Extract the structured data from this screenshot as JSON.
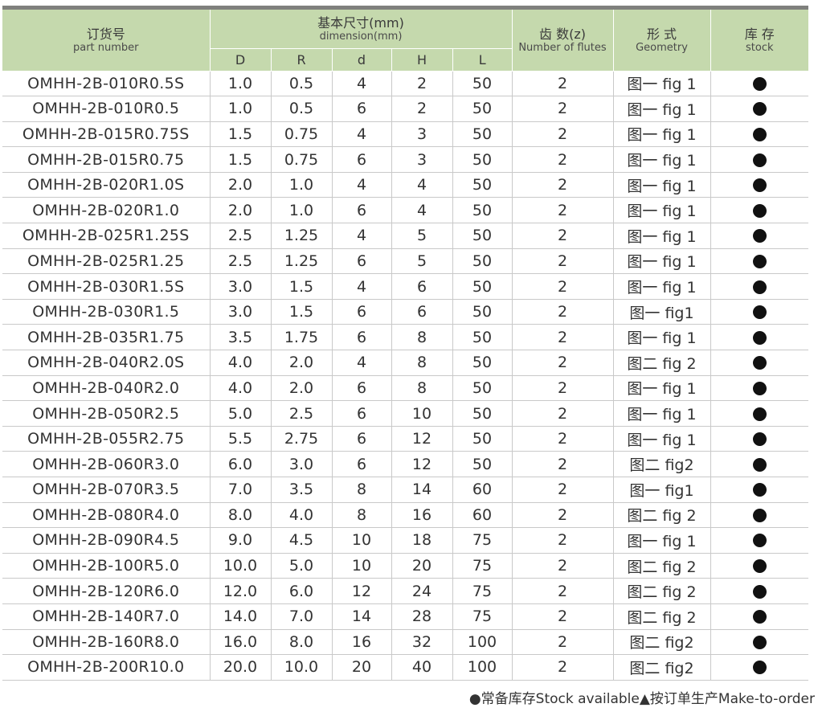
{
  "header": {
    "part_zh": "订货号",
    "part_en": "part number",
    "dim_zh": "基本尺寸(mm)",
    "dim_en": "dimension(mm)",
    "sub": [
      "D",
      "R",
      "d",
      "H",
      "L"
    ],
    "flutes_zh": "齿 数(z)",
    "flutes_en": "Number of flutes",
    "geom_zh": "形 式",
    "geom_en": "Geometry",
    "stock_zh": "库 存",
    "stock_en": "stock"
  },
  "rows": [
    {
      "pn": "OMHH-2B-010R0.5S",
      "D": "1.0",
      "R": "0.5",
      "d": "4",
      "H": "2",
      "L": "50",
      "z": "2",
      "geo": "图一 fig 1",
      "stock": "●"
    },
    {
      "pn": "OMHH-2B-010R0.5",
      "D": "1.0",
      "R": "0.5",
      "d": "6",
      "H": "2",
      "L": "50",
      "z": "2",
      "geo": "图一 fig 1",
      "stock": "●"
    },
    {
      "pn": "OMHH-2B-015R0.75S",
      "D": "1.5",
      "R": "0.75",
      "d": "4",
      "H": "3",
      "L": "50",
      "z": "2",
      "geo": "图一 fig 1",
      "stock": "●"
    },
    {
      "pn": "OMHH-2B-015R0.75",
      "D": "1.5",
      "R": "0.75",
      "d": "6",
      "H": "3",
      "L": "50",
      "z": "2",
      "geo": "图一 fig 1",
      "stock": "●"
    },
    {
      "pn": "OMHH-2B-020R1.0S",
      "D": "2.0",
      "R": "1.0",
      "d": "4",
      "H": "4",
      "L": "50",
      "z": "2",
      "geo": "图一 fig 1",
      "stock": "●"
    },
    {
      "pn": "OMHH-2B-020R1.0",
      "D": "2.0",
      "R": "1.0",
      "d": "6",
      "H": "4",
      "L": "50",
      "z": "2",
      "geo": "图一 fig 1",
      "stock": "●"
    },
    {
      "pn": "OMHH-2B-025R1.25S",
      "D": "2.5",
      "R": "1.25",
      "d": "4",
      "H": "5",
      "L": "50",
      "z": "2",
      "geo": "图一 fig 1",
      "stock": "●"
    },
    {
      "pn": "OMHH-2B-025R1.25",
      "D": "2.5",
      "R": "1.25",
      "d": "6",
      "H": "5",
      "L": "50",
      "z": "2",
      "geo": "图一 fig 1",
      "stock": "●"
    },
    {
      "pn": "OMHH-2B-030R1.5S",
      "D": "3.0",
      "R": "1.5",
      "d": "4",
      "H": "6",
      "L": "50",
      "z": "2",
      "geo": "图一 fig 1",
      "stock": "●"
    },
    {
      "pn": "OMHH-2B-030R1.5",
      "D": "3.0",
      "R": "1.5",
      "d": "6",
      "H": "6",
      "L": "50",
      "z": "2",
      "geo": "图一 fig1",
      "stock": "●"
    },
    {
      "pn": "OMHH-2B-035R1.75",
      "D": "3.5",
      "R": "1.75",
      "d": "6",
      "H": "8",
      "L": "50",
      "z": "2",
      "geo": "图一 fig 1",
      "stock": "●"
    },
    {
      "pn": "OMHH-2B-040R2.0S",
      "D": "4.0",
      "R": "2.0",
      "d": "4",
      "H": "8",
      "L": "50",
      "z": "2",
      "geo": "图二 fig 2",
      "stock": "●"
    },
    {
      "pn": "OMHH-2B-040R2.0",
      "D": "4.0",
      "R": "2.0",
      "d": "6",
      "H": "8",
      "L": "50",
      "z": "2",
      "geo": "图一 fig 1",
      "stock": "●"
    },
    {
      "pn": "OMHH-2B-050R2.5",
      "D": "5.0",
      "R": "2.5",
      "d": "6",
      "H": "10",
      "L": "50",
      "z": "2",
      "geo": "图一 fig 1",
      "stock": "●"
    },
    {
      "pn": "OMHH-2B-055R2.75",
      "D": "5.5",
      "R": "2.75",
      "d": "6",
      "H": "12",
      "L": "50",
      "z": "2",
      "geo": "图一 fig 1",
      "stock": "●"
    },
    {
      "pn": "OMHH-2B-060R3.0",
      "D": "6.0",
      "R": "3.0",
      "d": "6",
      "H": "12",
      "L": "50",
      "z": "2",
      "geo": "图二 fig2",
      "stock": "●"
    },
    {
      "pn": "OMHH-2B-070R3.5",
      "D": "7.0",
      "R": "3.5",
      "d": "8",
      "H": "14",
      "L": "60",
      "z": "2",
      "geo": "图一 fig1",
      "stock": "●"
    },
    {
      "pn": "OMHH-2B-080R4.0",
      "D": "8.0",
      "R": "4.0",
      "d": "8",
      "H": "16",
      "L": "60",
      "z": "2",
      "geo": "图二 fig 2",
      "stock": "●"
    },
    {
      "pn": "OMHH-2B-090R4.5",
      "D": "9.0",
      "R": "4.5",
      "d": "10",
      "H": "18",
      "L": "75",
      "z": "2",
      "geo": "图一 fig 1",
      "stock": "●"
    },
    {
      "pn": "OMHH-2B-100R5.0",
      "D": "10.0",
      "R": "5.0",
      "d": "10",
      "H": "20",
      "L": "75",
      "z": "2",
      "geo": "图二 fig 2",
      "stock": "●"
    },
    {
      "pn": "OMHH-2B-120R6.0",
      "D": "12.0",
      "R": "6.0",
      "d": "12",
      "H": "24",
      "L": "75",
      "z": "2",
      "geo": "图二 fig 2",
      "stock": "●"
    },
    {
      "pn": "OMHH-2B-140R7.0",
      "D": "14.0",
      "R": "7.0",
      "d": "14",
      "H": "28",
      "L": "75",
      "z": "2",
      "geo": "图二 fig 2",
      "stock": "●"
    },
    {
      "pn": "OMHH-2B-160R8.0",
      "D": "16.0",
      "R": "8.0",
      "d": "16",
      "H": "32",
      "L": "100",
      "z": "2",
      "geo": "图二 fig2",
      "stock": "●"
    },
    {
      "pn": "OMHH-2B-200R10.0",
      "D": "20.0",
      "R": "10.0",
      "d": "20",
      "H": "40",
      "L": "100",
      "z": "2",
      "geo": "图二 fig2",
      "stock": "●"
    }
  ],
  "legend": "●常备库存Stock available▲按订单生产Make-to-order"
}
